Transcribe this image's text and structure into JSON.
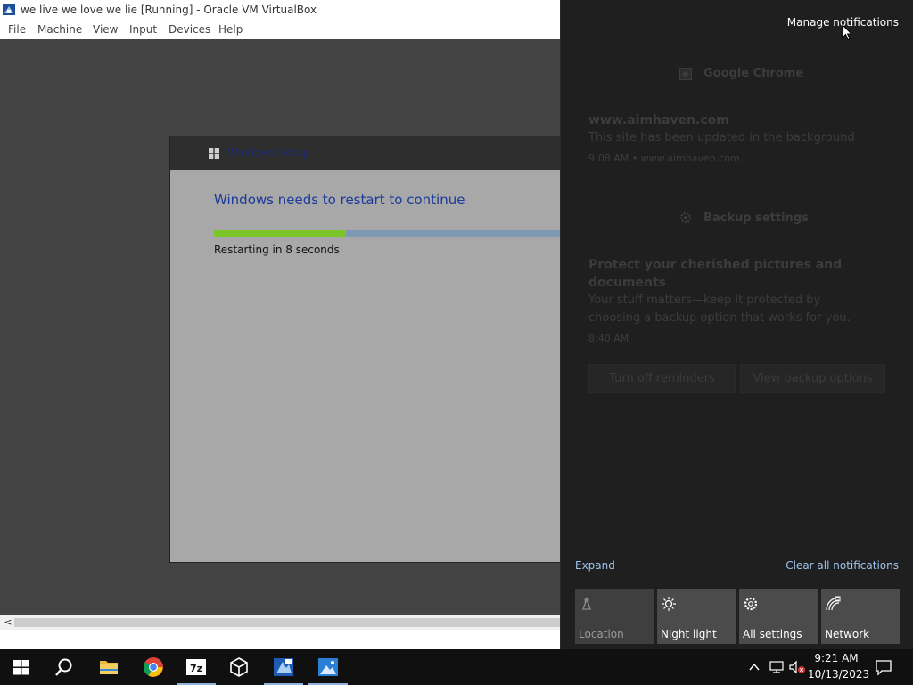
{
  "vbox": {
    "title": "we live we love we lie [Running] - Oracle VM VirtualBox",
    "menu": [
      "File",
      "Machine",
      "View",
      "Input",
      "Devices",
      "Help"
    ],
    "scroll_left": "<",
    "icon": "virtualbox-icon"
  },
  "setup": {
    "window_title": "Windows Setup",
    "heading": "Windows needs to restart to continue",
    "progress_fraction": 0.38,
    "status": "Restarting in 8 seconds"
  },
  "action_center": {
    "manage": "Manage notifications",
    "groups": [
      {
        "app": "Google Chrome",
        "icon": "chrome-icon",
        "title": "www.aimhaven.com",
        "body": "This site has been updated in the background",
        "meta": "9:08 AM • www.aimhaven.com"
      },
      {
        "app": "Backup settings",
        "icon": "gear-icon",
        "title_lines": [
          "Protect your cherished pictures and",
          "documents"
        ],
        "body_lines": [
          "Your stuff matters—keep it protected by",
          "choosing a backup option that works for you."
        ],
        "meta": "8:40 AM",
        "buttons": [
          "Turn off reminders",
          "View backup options"
        ]
      }
    ],
    "expand": "Expand",
    "clear_all": "Clear all notifications",
    "quick_actions": [
      {
        "label": "Location",
        "icon": "location-icon",
        "active": false
      },
      {
        "label": "Night light",
        "icon": "night-light-icon",
        "active": true
      },
      {
        "label": "All settings",
        "icon": "settings-gear-icon",
        "active": true
      },
      {
        "label": "Network",
        "icon": "network-icon",
        "active": true
      }
    ]
  },
  "taskbar": {
    "items": [
      "start-icon",
      "search-icon",
      "file-explorer-icon",
      "chrome-icon",
      "7zip-icon",
      "virtualbox-icon",
      "virtualbox-app-icon",
      "photos-icon"
    ],
    "seven_zip_label": "7z",
    "time": "9:21 AM",
    "date": "10/13/2023"
  },
  "colors": {
    "accent_link": "#9fc3ec",
    "progress_fill": "#7cc62a",
    "progress_track": "#7f98b4",
    "action_center_bg": "#1f1f1f",
    "taskbar_bg": "#101010"
  }
}
